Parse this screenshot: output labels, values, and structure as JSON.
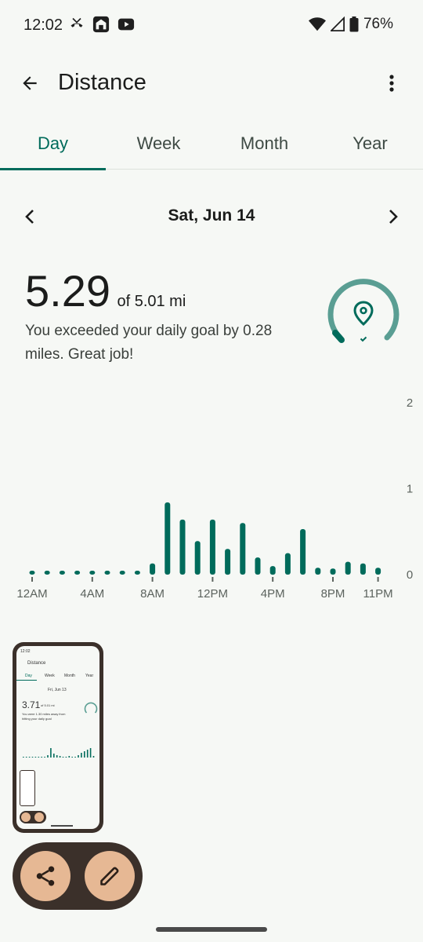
{
  "status_bar": {
    "time": "12:02",
    "battery": "76%",
    "icons": [
      "missed-call-icon",
      "home-app-icon",
      "youtube-icon",
      "wifi-icon",
      "cell-signal-icon",
      "battery-icon"
    ]
  },
  "app_bar": {
    "title": "Distance",
    "back_icon": "arrow-back-icon",
    "menu_icon": "more-vert-icon"
  },
  "tabs": [
    {
      "label": "Day",
      "active": true
    },
    {
      "label": "Week",
      "active": false
    },
    {
      "label": "Month",
      "active": false
    },
    {
      "label": "Year",
      "active": false
    }
  ],
  "date_nav": {
    "label": "Sat, Jun 14"
  },
  "summary": {
    "value": "5.29",
    "goal": "of 5.01 mi",
    "message": "You exceeded your daily goal by 0.28 miles. Great job!",
    "progress_fraction": 1.0,
    "accent_color": "#006b5b",
    "ring_color": "#5a9e93"
  },
  "chart_data": {
    "type": "bar",
    "title": "",
    "categories": [
      "12AM",
      "1AM",
      "2AM",
      "3AM",
      "4AM",
      "5AM",
      "6AM",
      "7AM",
      "8AM",
      "9AM",
      "10AM",
      "11AM",
      "12PM",
      "1PM",
      "2PM",
      "3PM",
      "4PM",
      "5PM",
      "6PM",
      "7PM",
      "8PM",
      "9PM",
      "10PM",
      "11PM"
    ],
    "values": [
      0.0,
      0.0,
      0.0,
      0.0,
      0.0,
      0.0,
      0.0,
      0.0,
      0.13,
      0.84,
      0.64,
      0.39,
      0.64,
      0.3,
      0.6,
      0.2,
      0.1,
      0.25,
      0.53,
      0.08,
      0.07,
      0.15,
      0.13,
      0.08
    ],
    "x_tick_labels": [
      "12AM",
      "4AM",
      "8AM",
      "12PM",
      "4PM",
      "8PM",
      "11PM"
    ],
    "y_tick_labels": [
      "2",
      "1",
      "0"
    ],
    "ylim": [
      0,
      2
    ],
    "grid": false,
    "bar_color": "#006b5b"
  },
  "thumbnail": {
    "time": "12:02",
    "title": "Distance",
    "tabs": [
      "Day",
      "Week",
      "Month",
      "Year"
    ],
    "date": "Fri, Jun 13",
    "value": "3.71",
    "goal": "of 5.01 mi",
    "message": "You were 1.30 miles away from hitting your daily goal"
  },
  "actions": {
    "share_icon": "share-icon",
    "edit_icon": "edit-pencil-icon",
    "pill_color": "#3b302a",
    "button_color": "#e6b894"
  }
}
